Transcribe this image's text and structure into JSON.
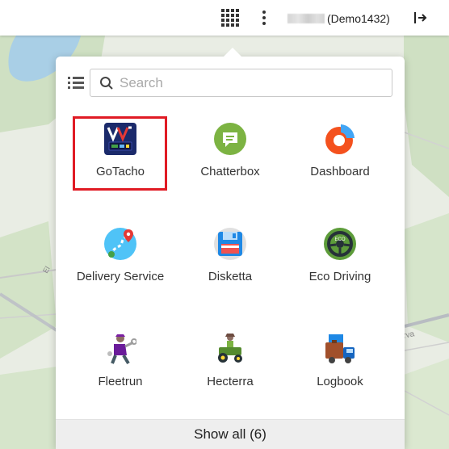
{
  "topbar": {
    "apps_icon": "apps-grid-icon",
    "menu_icon": "kebab-menu-icon",
    "user_tag": "(Demo1432)",
    "logout_icon": "logout-icon"
  },
  "map": {
    "road_label_left": "El",
    "road_label_right": "rva"
  },
  "launcher": {
    "search": {
      "placeholder": "Search",
      "value": ""
    },
    "list_view_icon": "list-view-icon",
    "apps": [
      {
        "label": "GoTacho",
        "icon": "gotacho-icon",
        "highlighted": true
      },
      {
        "label": "Chatterbox",
        "icon": "chat-bubble-icon"
      },
      {
        "label": "Dashboard",
        "icon": "dashboard-pie-icon"
      },
      {
        "label": "Delivery Service",
        "icon": "delivery-route-icon"
      },
      {
        "label": "Disketta",
        "icon": "floppy-disk-icon"
      },
      {
        "label": "Eco Driving",
        "icon": "eco-steering-wheel-icon"
      },
      {
        "label": "Fleetrun",
        "icon": "mechanic-icon"
      },
      {
        "label": "Hecterra",
        "icon": "tractor-icon"
      },
      {
        "label": "Logbook",
        "icon": "truck-logbook-icon"
      }
    ],
    "show_all": "Show all (6)"
  },
  "colors": {
    "highlight": "#e01b24",
    "chatterbox": "#7cb342",
    "dashboard": "#f4511e",
    "map_bg": "#e9ede4",
    "water": "#a9cfe6"
  }
}
